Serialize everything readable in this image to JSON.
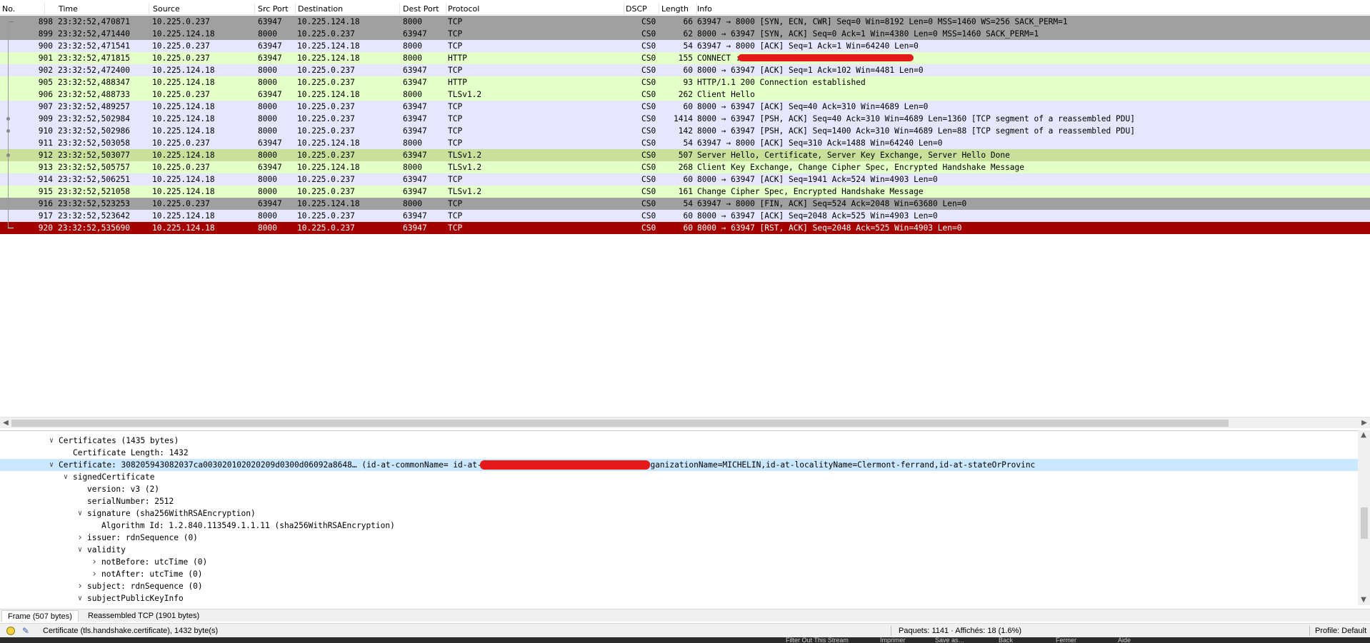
{
  "columns": [
    "No.",
    "Time",
    "Source",
    "Src Port",
    "Destination",
    "Dest Port",
    "Protocol",
    "DSCP",
    "Length",
    "Info"
  ],
  "colors": {
    "tcp": "#e7e6ff",
    "http": "#e4ffc7",
    "tls": "#e4ffc7",
    "dark": "#a0a0a0",
    "selected": "#c8e09a",
    "rst": "#a40000",
    "detail_selected": "#cce8ff"
  },
  "packets": [
    {
      "no": "898",
      "time": "23:32:52,470871",
      "src": "10.225.0.237",
      "sport": "63947",
      "dst": "10.225.124.18",
      "dport": "8000",
      "proto": "TCP",
      "dscp": "CS0",
      "len": "66",
      "info": "63947 → 8000 [SYN, ECN, CWR] Seq=0 Win=8192 Len=0 MSS=1460 WS=256 SACK_PERM=1",
      "style": "dark",
      "rel": "top"
    },
    {
      "no": "899",
      "time": "23:32:52,471440",
      "src": "10.225.124.18",
      "sport": "8000",
      "dst": "10.225.0.237",
      "dport": "63947",
      "proto": "TCP",
      "dscp": "CS0",
      "len": "62",
      "info": "8000 → 63947 [SYN, ACK] Seq=0 Ack=1 Win=4380 Len=0 MSS=1460 SACK_PERM=1",
      "style": "dark",
      "rel": "line"
    },
    {
      "no": "900",
      "time": "23:32:52,471541",
      "src": "10.225.0.237",
      "sport": "63947",
      "dst": "10.225.124.18",
      "dport": "8000",
      "proto": "TCP",
      "dscp": "CS0",
      "len": "54",
      "info": "63947 → 8000 [ACK] Seq=1 Ack=1 Win=64240 Len=0",
      "style": "tcp",
      "rel": "line"
    },
    {
      "no": "901",
      "time": "23:32:52,471815",
      "src": "10.225.0.237",
      "sport": "63947",
      "dst": "10.225.124.18",
      "dport": "8000",
      "proto": "HTTP",
      "dscp": "CS0",
      "len": "155",
      "info": "CONNECT                         :443 HTTP/1.1",
      "style": "http",
      "rel": "line",
      "redact": true
    },
    {
      "no": "902",
      "time": "23:32:52,472400",
      "src": "10.225.124.18",
      "sport": "8000",
      "dst": "10.225.0.237",
      "dport": "63947",
      "proto": "TCP",
      "dscp": "CS0",
      "len": "60",
      "info": "8000 → 63947 [ACK] Seq=1 Ack=102 Win=4481 Len=0",
      "style": "tcp",
      "rel": "line"
    },
    {
      "no": "905",
      "time": "23:32:52,488347",
      "src": "10.225.124.18",
      "sport": "8000",
      "dst": "10.225.0.237",
      "dport": "63947",
      "proto": "HTTP",
      "dscp": "CS0",
      "len": "93",
      "info": "HTTP/1.1 200 Connection established",
      "style": "http",
      "rel": "line"
    },
    {
      "no": "906",
      "time": "23:32:52,488733",
      "src": "10.225.0.237",
      "sport": "63947",
      "dst": "10.225.124.18",
      "dport": "8000",
      "proto": "TLSv1.2",
      "dscp": "CS0",
      "len": "262",
      "info": "Client Hello",
      "style": "tls",
      "rel": "line"
    },
    {
      "no": "907",
      "time": "23:32:52,489257",
      "src": "10.225.124.18",
      "sport": "8000",
      "dst": "10.225.0.237",
      "dport": "63947",
      "proto": "TCP",
      "dscp": "CS0",
      "len": "60",
      "info": "8000 → 63947 [ACK] Seq=40 Ack=310 Win=4689 Len=0",
      "style": "tcp",
      "rel": "line"
    },
    {
      "no": "909",
      "time": "23:32:52,502984",
      "src": "10.225.124.18",
      "sport": "8000",
      "dst": "10.225.0.237",
      "dport": "63947",
      "proto": "TCP",
      "dscp": "CS0",
      "len": "1414",
      "info": "8000 → 63947 [PSH, ACK] Seq=40 Ack=310 Win=4689 Len=1360 [TCP segment of a reassembled PDU]",
      "style": "tcp",
      "rel": "dot"
    },
    {
      "no": "910",
      "time": "23:32:52,502986",
      "src": "10.225.124.18",
      "sport": "8000",
      "dst": "10.225.0.237",
      "dport": "63947",
      "proto": "TCP",
      "dscp": "CS0",
      "len": "142",
      "info": "8000 → 63947 [PSH, ACK] Seq=1400 Ack=310 Win=4689 Len=88 [TCP segment of a reassembled PDU]",
      "style": "tcp",
      "rel": "dot"
    },
    {
      "no": "911",
      "time": "23:32:52,503058",
      "src": "10.225.0.237",
      "sport": "63947",
      "dst": "10.225.124.18",
      "dport": "8000",
      "proto": "TCP",
      "dscp": "CS0",
      "len": "54",
      "info": "63947 → 8000 [ACK] Seq=310 Ack=1488 Win=64240 Len=0",
      "style": "tcp",
      "rel": "line"
    },
    {
      "no": "912",
      "time": "23:32:52,503077",
      "src": "10.225.124.18",
      "sport": "8000",
      "dst": "10.225.0.237",
      "dport": "63947",
      "proto": "TLSv1.2",
      "dscp": "CS0",
      "len": "507",
      "info": "Server Hello, Certificate, Server Key Exchange, Server Hello Done",
      "style": "selected",
      "rel": "dot"
    },
    {
      "no": "913",
      "time": "23:32:52,505757",
      "src": "10.225.0.237",
      "sport": "63947",
      "dst": "10.225.124.18",
      "dport": "8000",
      "proto": "TLSv1.2",
      "dscp": "CS0",
      "len": "268",
      "info": "Client Key Exchange, Change Cipher Spec, Encrypted Handshake Message",
      "style": "tls",
      "rel": "line"
    },
    {
      "no": "914",
      "time": "23:32:52,506251",
      "src": "10.225.124.18",
      "sport": "8000",
      "dst": "10.225.0.237",
      "dport": "63947",
      "proto": "TCP",
      "dscp": "CS0",
      "len": "60",
      "info": "8000 → 63947 [ACK] Seq=1941 Ack=524 Win=4903 Len=0",
      "style": "tcp",
      "rel": "line"
    },
    {
      "no": "915",
      "time": "23:32:52,521058",
      "src": "10.225.124.18",
      "sport": "8000",
      "dst": "10.225.0.237",
      "dport": "63947",
      "proto": "TLSv1.2",
      "dscp": "CS0",
      "len": "161",
      "info": "Change Cipher Spec, Encrypted Handshake Message",
      "style": "tls",
      "rel": "line"
    },
    {
      "no": "916",
      "time": "23:32:52,523253",
      "src": "10.225.0.237",
      "sport": "63947",
      "dst": "10.225.124.18",
      "dport": "8000",
      "proto": "TCP",
      "dscp": "CS0",
      "len": "54",
      "info": "63947 → 8000 [FIN, ACK] Seq=524 Ack=2048 Win=63680 Len=0",
      "style": "dark",
      "rel": "line"
    },
    {
      "no": "917",
      "time": "23:32:52,523642",
      "src": "10.225.124.18",
      "sport": "8000",
      "dst": "10.225.0.237",
      "dport": "63947",
      "proto": "TCP",
      "dscp": "CS0",
      "len": "60",
      "info": "8000 → 63947 [ACK] Seq=2048 Ack=525 Win=4903 Len=0",
      "style": "tcp",
      "rel": "line"
    },
    {
      "no": "920",
      "time": "23:32:52,535690",
      "src": "10.225.124.18",
      "sport": "8000",
      "dst": "10.225.0.237",
      "dport": "63947",
      "proto": "TCP",
      "dscp": "CS0",
      "len": "60",
      "info": "8000 → 63947 [RST, ACK] Seq=2048 Ack=525 Win=4903 Len=0",
      "style": "rst",
      "rel": "end"
    }
  ],
  "detail": [
    {
      "indent": 0,
      "toggle": "open",
      "text": "Certificates (1435 bytes)"
    },
    {
      "indent": 1,
      "toggle": "none",
      "text": "Certificate Length: 1432"
    },
    {
      "indent": 0,
      "toggle": "open",
      "text": "Certificate: 308205943082037ca003020102020209d0300d06092a8648… (id-at-commonName=                       id-at-organizationalUnitName=EUX,id-at-organizationName=MICHELIN,id-at-localityName=Clermont-ferrand,id-at-stateOrProvinc",
      "selected": true,
      "redact": true
    },
    {
      "indent": 1,
      "toggle": "open",
      "text": "signedCertificate"
    },
    {
      "indent": 2,
      "toggle": "none",
      "text": "version: v3 (2)"
    },
    {
      "indent": 2,
      "toggle": "none",
      "text": "serialNumber: 2512"
    },
    {
      "indent": 2,
      "toggle": "open",
      "text": "signature (sha256WithRSAEncryption)"
    },
    {
      "indent": 3,
      "toggle": "none",
      "text": "Algorithm Id: 1.2.840.113549.1.1.11 (sha256WithRSAEncryption)"
    },
    {
      "indent": 2,
      "toggle": "closed",
      "text": "issuer: rdnSequence (0)"
    },
    {
      "indent": 2,
      "toggle": "open",
      "text": "validity"
    },
    {
      "indent": 3,
      "toggle": "closed",
      "text": "notBefore: utcTime (0)"
    },
    {
      "indent": 3,
      "toggle": "closed",
      "text": "notAfter: utcTime (0)"
    },
    {
      "indent": 2,
      "toggle": "closed",
      "text": "subject: rdnSequence (0)"
    },
    {
      "indent": 2,
      "toggle": "open",
      "text": "subjectPublicKeyInfo"
    }
  ],
  "bytes_tabs": [
    "Frame (507 bytes)",
    "Reassembled TCP (1901 bytes)"
  ],
  "status": {
    "field": "Certificate (tls.handshake.certificate), 1432 byte(s)",
    "packets": "Paquets: 1141 · Affichés: 18 (1.6%)",
    "profile": "Profile: Default"
  },
  "taskbar": [
    "Filter Out This Stream",
    "Imprimer",
    "Save as…",
    "Back",
    "Fermer",
    "Aide"
  ],
  "icons": {
    "expert": "expert-info-icon",
    "edit": "edit-comment-icon",
    "expanded": "chevron-down-icon",
    "collapsed": "chevron-right-icon",
    "scroll_left": "arrow-left-icon",
    "scroll_right": "arrow-right-icon",
    "scroll_up": "arrow-up-icon",
    "scroll_down": "arrow-down-icon"
  }
}
